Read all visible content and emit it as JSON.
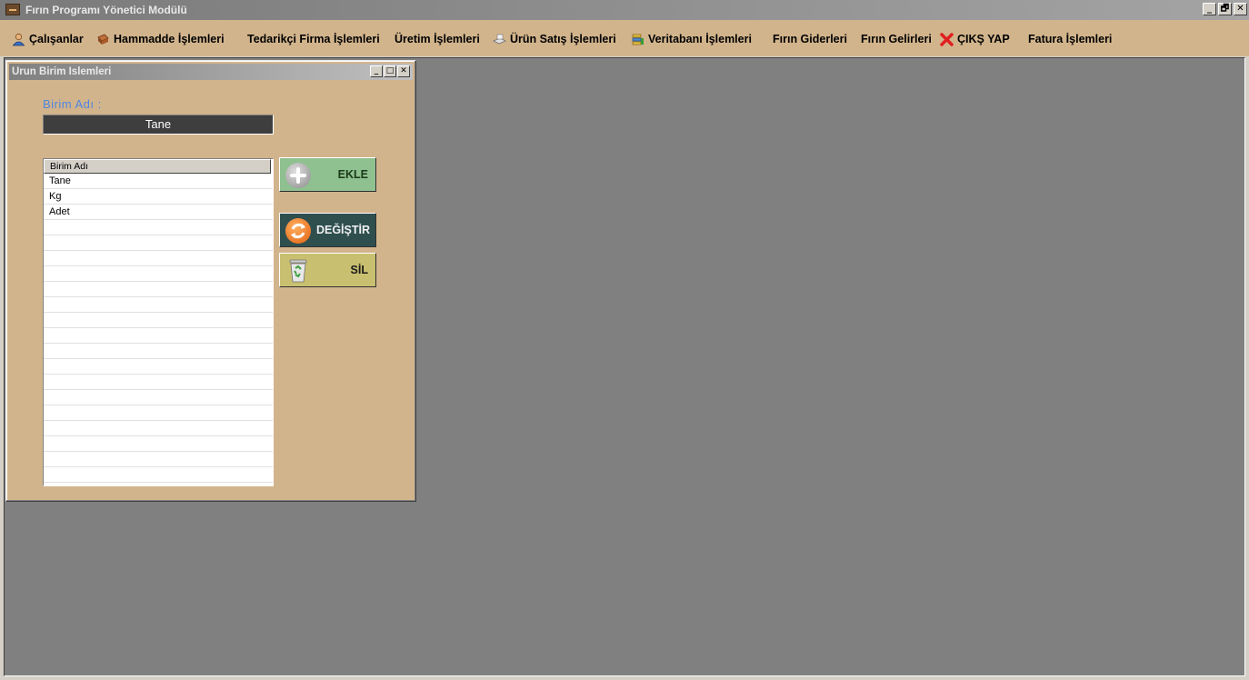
{
  "window": {
    "title": "Fırın Programı Yönetici Modülü",
    "controls": [
      "_",
      "🗗",
      "✕"
    ]
  },
  "menu": [
    {
      "label": "Çalışanlar",
      "icon": "person-icon"
    },
    {
      "label": "Hammadde  İşlemleri",
      "icon": "materials-icon"
    },
    {
      "label": "Tedarikçi Firma İşlemleri",
      "icon": ""
    },
    {
      "label": "Üretim İşlemleri",
      "icon": ""
    },
    {
      "label": "Ürün Satış İşlemleri",
      "icon": "sales-icon"
    },
    {
      "label": "Veritabanı İşlemleri",
      "icon": "database-icon"
    },
    {
      "label": "Fırın Giderleri",
      "icon": ""
    },
    {
      "label": "Fırın Gelirleri",
      "icon": ""
    },
    {
      "label": "ÇIKŞ YAP",
      "icon": "exit-x-icon"
    },
    {
      "label": "Fatura İşlemleri",
      "icon": ""
    }
  ],
  "child_window": {
    "title": "Urun Birim Islemleri",
    "field_label": "Birim  Adı :",
    "field_value": "Tane",
    "list_header": "Birim Adı",
    "list_items": [
      "Tane",
      "Kg",
      "Adet"
    ],
    "buttons": {
      "add": "EKLE",
      "update": "DEĞİŞTİR",
      "delete": "SİL"
    },
    "colors": {
      "add": "#8fc08f",
      "update": "#2f4f4f",
      "delete": "#c8c070"
    }
  }
}
